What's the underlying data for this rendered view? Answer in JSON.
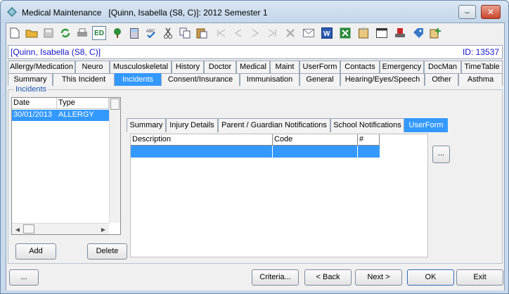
{
  "window": {
    "title": "Medical Maintenance   [Quinn, Isabella (S8, C)]: 2012 Semester 1",
    "minimize_label": "‒",
    "close_label": "✕"
  },
  "toolbar": {
    "icons": [
      "new-icon",
      "open-icon",
      "save-icon",
      "refresh-icon",
      "print-icon",
      "ed-icon",
      "tree-icon",
      "calculator-icon",
      "spellcheck-icon",
      "cut-icon",
      "copy-icon",
      "paste-icon",
      "first-record-icon",
      "previous-record-icon",
      "next-record-icon",
      "last-record-icon",
      "delete-icon",
      "email-icon",
      "word-icon",
      "excel-icon",
      "clipboard-icon",
      "calendar-icon",
      "stamp-icon",
      "tag-icon",
      "add-note-icon"
    ],
    "ed_label": "ED"
  },
  "patient": {
    "name": "[Quinn, Isabella (S8, C)]",
    "id": "ID: 13537"
  },
  "tabs_row1": [
    "Allergy/Medication",
    "Neuro",
    "Musculoskeletal",
    "History",
    "Doctor",
    "Medical",
    "Maint",
    "UserForm",
    "Contacts",
    "Emergency",
    "DocMan",
    "TimeTable"
  ],
  "tabs_row2": [
    "Summary",
    "This Incident",
    "Incidents",
    "Consent/Insurance",
    "Immunisation",
    "General",
    "Hearing/Eyes/Speech",
    "Other",
    "Asthma"
  ],
  "tabs_row2_selected": "Incidents",
  "incidents": {
    "group_label": "Incidents",
    "columns": [
      "Date",
      "Type"
    ],
    "rows": [
      [
        "30/01/2013",
        "ALLERGY"
      ]
    ],
    "add_label": "Add",
    "delete_label": "Delete"
  },
  "sub_tabs": [
    "Summary",
    "Injury Details",
    "Parent / Guardian Notifications",
    "School Notifications",
    "UserForm"
  ],
  "sub_tabs_selected": "UserForm",
  "userform_grid": {
    "columns": [
      "Description",
      "Code",
      "#"
    ],
    "more_label": "..."
  },
  "bottom": {
    "dots_label": "...",
    "criteria_label": "Criteria...",
    "back_label": "< Back",
    "next_label": "Next >",
    "ok_label": "OK",
    "exit_label": "Exit"
  },
  "colors": {
    "selection": "#3399ff",
    "patient_text": "#1515c8",
    "group_label": "#1a56b0"
  }
}
